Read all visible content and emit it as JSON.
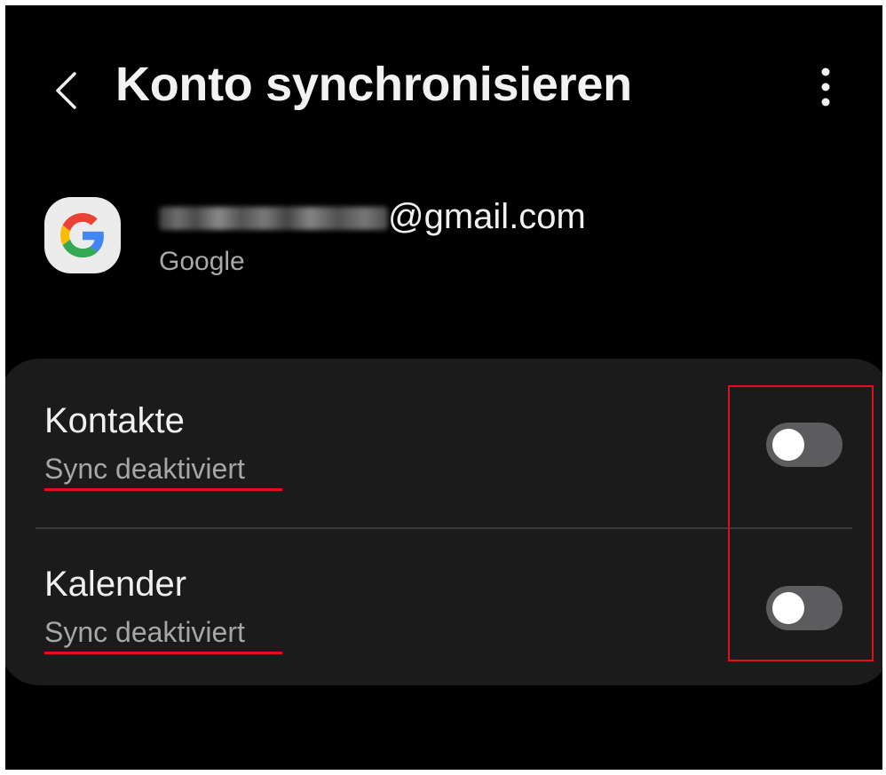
{
  "header": {
    "title": "Konto synchronisieren",
    "back_icon": "chevron-left-icon",
    "more_icon": "more-vertical-icon"
  },
  "account": {
    "icon": "google-logo-icon",
    "email_domain": "@gmail.com",
    "email_local_part_obscured": true,
    "type": "Google"
  },
  "sync_items": [
    {
      "label": "Kontakte",
      "status": "Sync deaktiviert",
      "enabled": false
    },
    {
      "label": "Kalender",
      "status": "Sync deaktiviert",
      "enabled": false
    }
  ],
  "colors": {
    "background": "#000000",
    "card": "#1b1b1c",
    "toggle_off_track": "#5c5c5e",
    "annotation_red": "#e0101a",
    "text_primary": "#f0f0f0",
    "text_secondary": "#a6a6a6"
  },
  "annotations": {
    "toggle_highlight_box": true,
    "status_underlines": true
  }
}
